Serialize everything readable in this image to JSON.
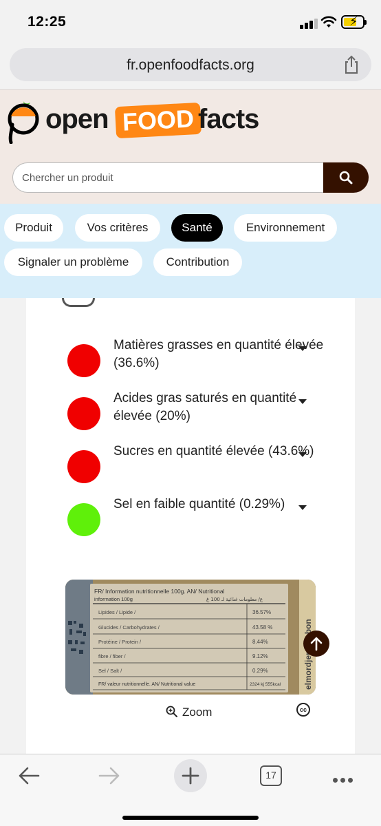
{
  "status_bar": {
    "time": "12:25"
  },
  "browser": {
    "url": "fr.openfoodfacts.org",
    "tab_count": "17"
  },
  "header": {
    "logo_open": "open",
    "logo_food": "FOOD",
    "logo_facts": "facts",
    "search_placeholder": "Chercher un produit"
  },
  "tabs": [
    {
      "label": "Produit"
    },
    {
      "label": "Vos critères"
    },
    {
      "label": "Santé"
    },
    {
      "label": "Environnement"
    },
    {
      "label": "Signaler un problème"
    },
    {
      "label": "Contribution"
    }
  ],
  "active_tab": "Santé",
  "nutrients": [
    {
      "text": "Matières grasses en quantité élevée (36.6%)",
      "level": "high",
      "color": "#f00000"
    },
    {
      "text": "Acides gras saturés en quantité élevée (20%)",
      "level": "high",
      "color": "#f00000"
    },
    {
      "text": "Sucres en quantité élevée (43.6%)",
      "level": "high",
      "color": "#f00000"
    },
    {
      "text": "Sel en faible quantité (0.29%)",
      "level": "low",
      "color": "#5ff00a"
    }
  ],
  "label_image": {
    "header_left": "FR/ Information nutritionnelle 100g. AN/ Nutritional",
    "header_sub": "information 100g",
    "header_right": "ع/ معلومات غذائية لـ 100 غ",
    "rows": [
      {
        "name": "Lipides / Lipide /",
        "value": "36.57%"
      },
      {
        "name": "Glucides / Carbohydrates /",
        "value": "43.58 %"
      },
      {
        "name": "Protéine / Protein /",
        "value": "8.44%"
      },
      {
        "name": "fibre / fiber /",
        "value": "9.12%"
      },
      {
        "name": "Sel / Salt /",
        "value": "0.29%"
      }
    ],
    "footer": "FR/ valeur nutritionnelle. AN/ Nutritional value",
    "footer_value": "2324 kj 555kcal",
    "side_text": "elmordjene.cebon"
  },
  "zoom_label": "Zoom",
  "license_icon": "cc",
  "colors": {
    "brand_orange": "#ff8714",
    "brand_brown": "#341100",
    "tabs_bg": "#d8eefa",
    "header_bg": "#f2e9e4"
  }
}
